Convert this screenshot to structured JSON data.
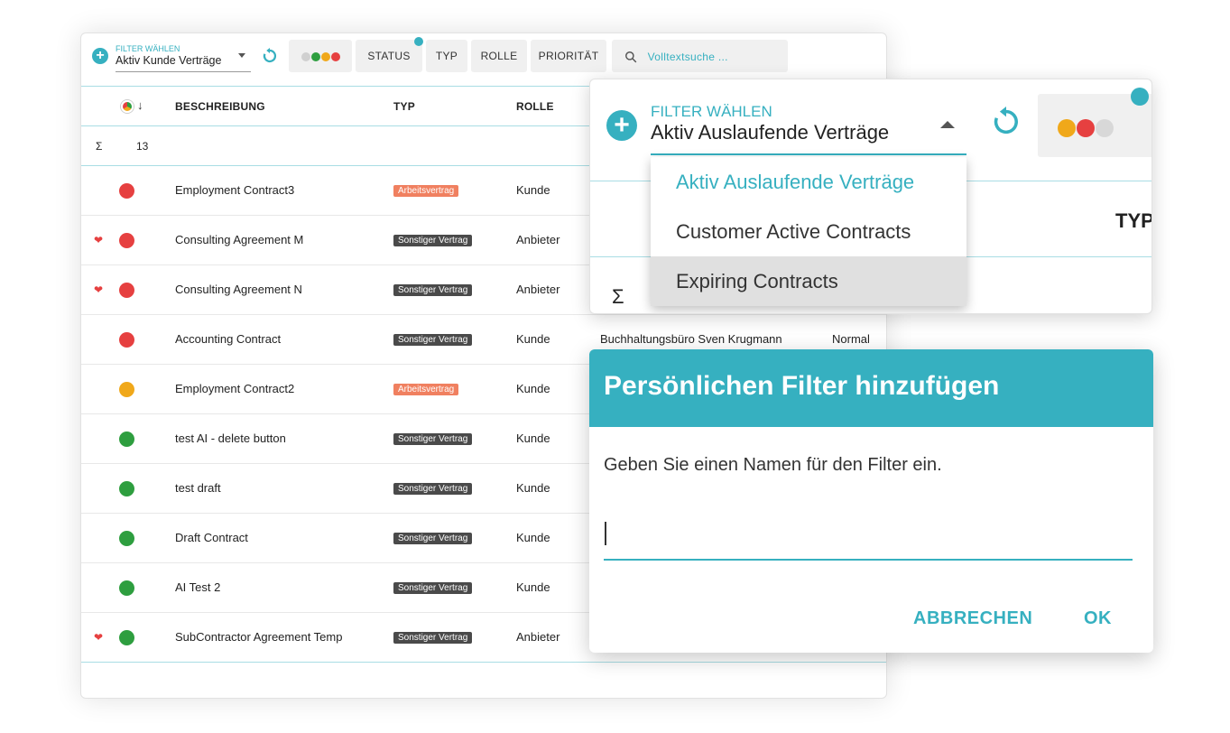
{
  "toolbar": {
    "filter_label": "FILTER WÄHLEN",
    "filter_value": "Aktiv Kunde Verträge",
    "status_label": "STATUS",
    "typ_label": "TYP",
    "rolle_label": "ROLLE",
    "prioritaet_label": "PRIORITÄT",
    "search_placeholder": "Volltextsuche ..."
  },
  "table": {
    "headers": {
      "beschreibung": "BESCHREIBUNG",
      "typ": "TYP",
      "rolle": "ROLLE"
    },
    "sum_symbol": "Σ",
    "count": "13",
    "rows": [
      {
        "favorite": false,
        "status": "red",
        "description": "Employment Contract3",
        "type": "Arbeitsvertrag",
        "role": "Kunde",
        "partner": "",
        "priority": ""
      },
      {
        "favorite": true,
        "status": "red",
        "description": "Consulting Agreement M",
        "type": "Sonstiger Vertrag",
        "role": "Anbieter",
        "partner": "",
        "priority": ""
      },
      {
        "favorite": true,
        "status": "red",
        "description": "Consulting Agreement N",
        "type": "Sonstiger Vertrag",
        "role": "Anbieter",
        "partner": "",
        "priority": ""
      },
      {
        "favorite": false,
        "status": "red",
        "description": "Accounting Contract",
        "type": "Sonstiger Vertrag",
        "role": "Kunde",
        "partner": "Buchhaltungsbüro Sven Krugmann",
        "priority": "Normal"
      },
      {
        "favorite": false,
        "status": "orange",
        "description": "Employment Contract2",
        "type": "Arbeitsvertrag",
        "role": "Kunde",
        "partner": "",
        "priority": ""
      },
      {
        "favorite": false,
        "status": "green",
        "description": "test AI - delete button",
        "type": "Sonstiger Vertrag",
        "role": "Kunde",
        "partner": "",
        "priority": ""
      },
      {
        "favorite": false,
        "status": "green",
        "description": "test draft",
        "type": "Sonstiger Vertrag",
        "role": "Kunde",
        "partner": "",
        "priority": ""
      },
      {
        "favorite": false,
        "status": "green",
        "description": "Draft Contract",
        "type": "Sonstiger Vertrag",
        "role": "Kunde",
        "partner": "",
        "priority": ""
      },
      {
        "favorite": false,
        "status": "green",
        "description": "AI Test 2",
        "type": "Sonstiger Vertrag",
        "role": "Kunde",
        "partner": "",
        "priority": ""
      },
      {
        "favorite": true,
        "status": "green",
        "description": "SubContractor Agreement Temp",
        "type": "Sonstiger Vertrag",
        "role": "Anbieter",
        "partner": "",
        "priority": ""
      }
    ]
  },
  "colors": {
    "accent": "#36b0c0",
    "red": "#e64040",
    "orange": "#f0a81a",
    "green": "#2e9e3f",
    "badge_arbeitsvertrag": "#f08060",
    "badge_sonstiger": "#4a4a4a"
  },
  "dropdown": {
    "label": "FILTER WÄHLEN",
    "value": "Aktiv Auslaufende Verträge",
    "typ_header": "TYP",
    "sum_symbol": "Σ",
    "options": [
      {
        "label": "Aktiv Auslaufende Verträge",
        "state": "selected"
      },
      {
        "label": "Customer Active Contracts",
        "state": "normal"
      },
      {
        "label": "Expiring Contracts",
        "state": "hover"
      }
    ]
  },
  "dialog": {
    "title": "Persönlichen Filter hinzufügen",
    "prompt": "Geben Sie einen Namen für den Filter ein.",
    "input_value": "",
    "cancel_label": "ABBRECHEN",
    "ok_label": "OK"
  },
  "icons": {
    "add": "plus-circle-icon",
    "refresh": "refresh-icon",
    "search": "search-icon",
    "caret": "caret-down-icon",
    "sort": "arrow-down-icon",
    "favorite": "heart-icon"
  }
}
